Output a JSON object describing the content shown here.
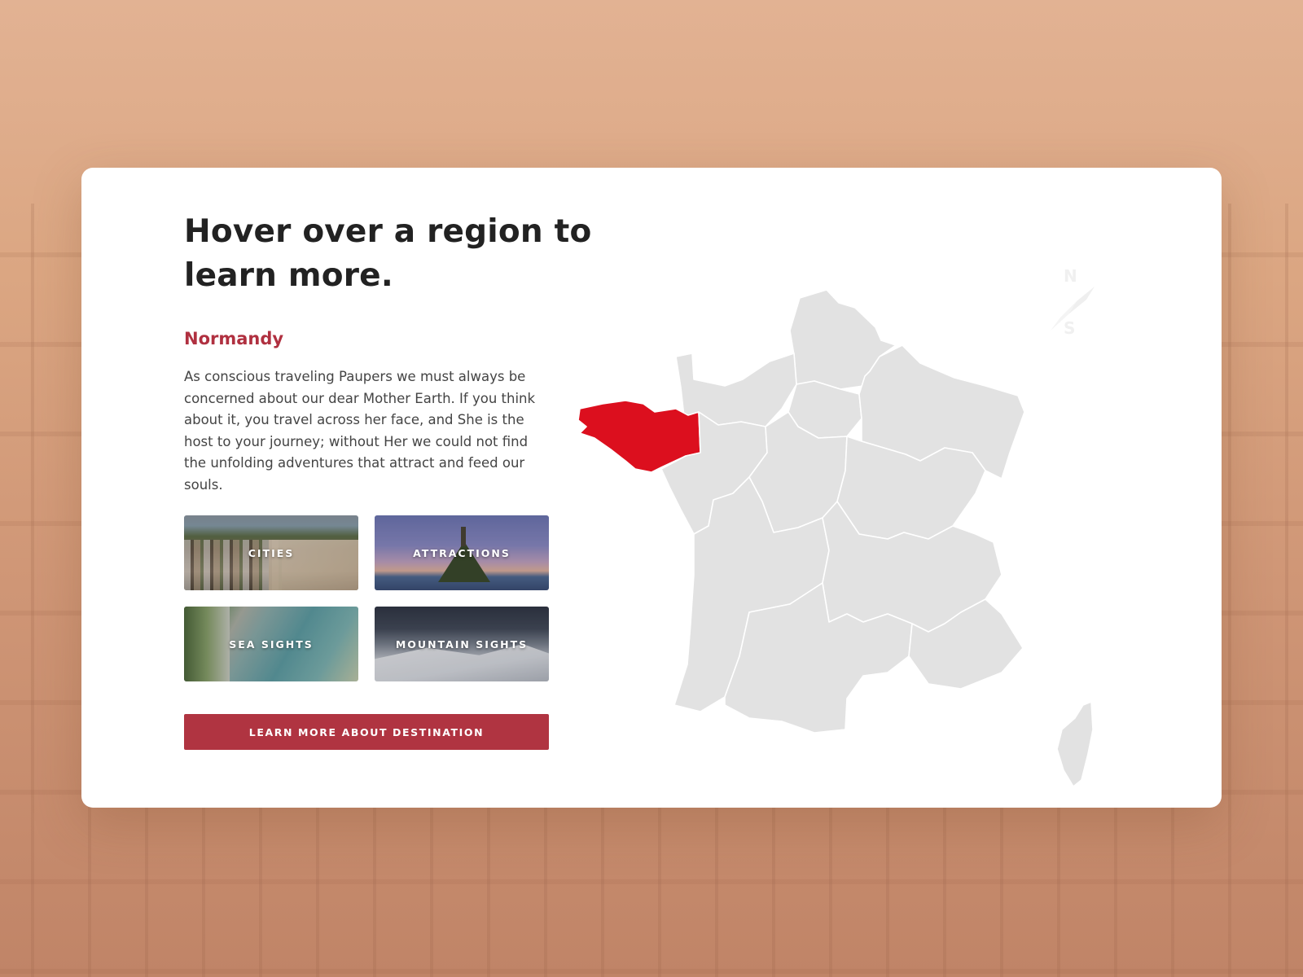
{
  "headline": "Hover over a region to learn more.",
  "selected_region": {
    "name": "Normandy",
    "description": "As conscious traveling Paupers we must always be concerned about our dear Mother Earth. If you think about it, you travel across her face, and She is the host to your journey; without Her we could not find the unfolding adventures that attract and feed our souls."
  },
  "tiles": [
    {
      "label": "CITIES",
      "icon": "cities-photo"
    },
    {
      "label": "ATTRACTIONS",
      "icon": "attractions-photo"
    },
    {
      "label": "SEA SIGHTS",
      "icon": "sea-sights-photo"
    },
    {
      "label": "MOUNTAIN SIGHTS",
      "icon": "mountain-sights-photo"
    }
  ],
  "cta_label": "LEARN MORE ABOUT DESTINATION",
  "map": {
    "country": "France",
    "highlighted_region_color": "#dc0f1e",
    "region_color": "#e2e2e2",
    "border_color": "#ffffff"
  },
  "compass": {
    "north": "N",
    "south": "S"
  },
  "colors": {
    "accent": "#b03441",
    "background": "#e0ae8e"
  }
}
